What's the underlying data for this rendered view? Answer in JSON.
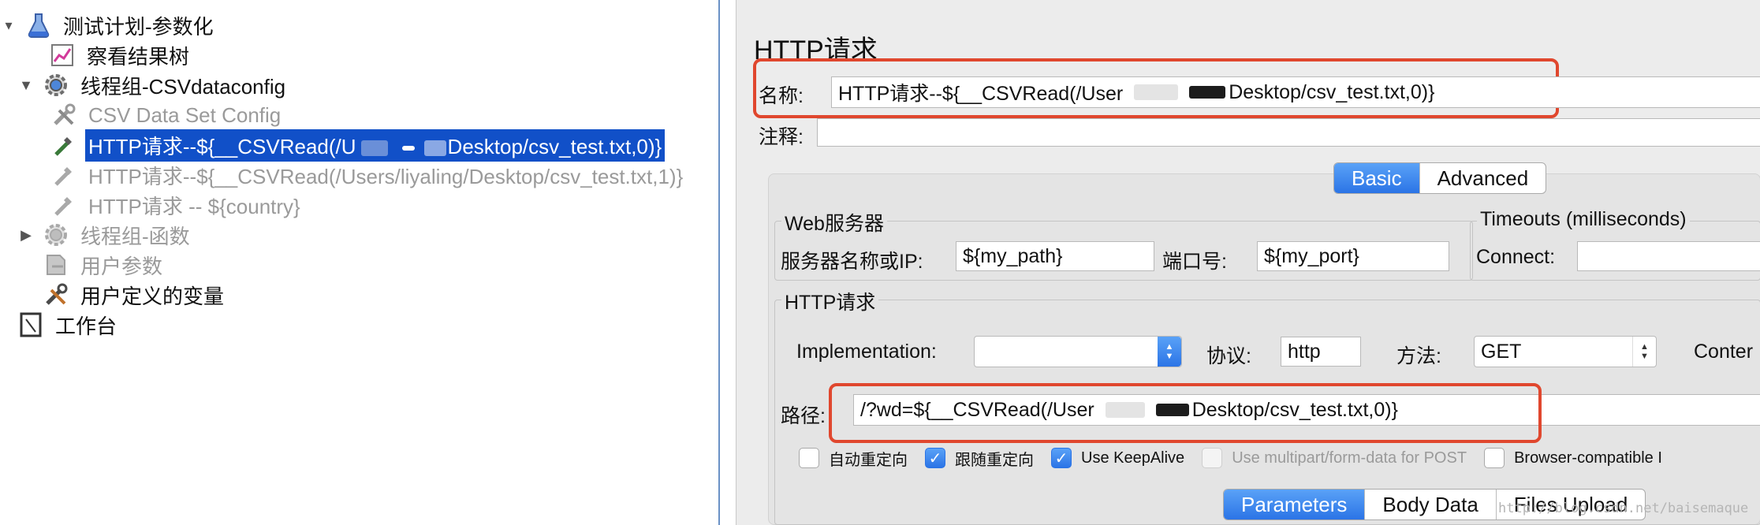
{
  "tree": {
    "items": [
      {
        "label": "测试计划-参数化",
        "icon": "flask-icon",
        "toggle": "▾",
        "disabled": false,
        "selected": false
      },
      {
        "label": "察看结果树",
        "icon": "chart-listener-icon",
        "toggle": "",
        "disabled": false,
        "selected": false
      },
      {
        "label": "线程组-CSVdataconfig",
        "icon": "gear-icon",
        "toggle": "▼",
        "disabled": false,
        "selected": false
      },
      {
        "label": "CSV Data Set Config",
        "icon": "wrench-icon",
        "toggle": "",
        "disabled": true,
        "selected": false
      },
      {
        "label_prefix": "HTTP请求--${__CSVRead(/U",
        "label_suffix": "Desktop/csv_test.txt,0)}",
        "icon": "pipette-icon",
        "toggle": "",
        "disabled": false,
        "selected": true
      },
      {
        "label": "HTTP请求--${__CSVRead(/Users/liyaling/Desktop/csv_test.txt,1)}",
        "icon": "pipette-icon",
        "toggle": "",
        "disabled": true,
        "selected": false
      },
      {
        "label": "HTTP请求 -- ${country}",
        "icon": "pipette-icon",
        "toggle": "",
        "disabled": true,
        "selected": false
      },
      {
        "label": "线程组-函数",
        "icon": "gear-icon",
        "toggle": "▶",
        "disabled": true,
        "selected": false
      },
      {
        "label": "用户参数",
        "icon": "document-icon",
        "toggle": "",
        "disabled": true,
        "selected": false
      },
      {
        "label": "用户定义的变量",
        "icon": "wrench-icon",
        "toggle": "",
        "disabled": false,
        "selected": false
      },
      {
        "label": "工作台",
        "icon": "workbench-icon",
        "toggle": "",
        "disabled": false,
        "selected": false
      }
    ]
  },
  "form": {
    "title": "HTTP请求",
    "name_label": "名称:",
    "name_value_prefix": "HTTP请求--${__CSVRead(/User",
    "name_value_suffix": "Desktop/csv_test.txt,0)}",
    "comment_label": "注释:",
    "comment_value": "",
    "tabs": [
      "Basic",
      "Advanced"
    ],
    "active_tab": "Basic",
    "web_server": {
      "title": "Web服务器",
      "server_label": "服务器名称或IP:",
      "server_value": "${my_path}",
      "port_label": "端口号:",
      "port_value": "${my_port}"
    },
    "timeouts": {
      "title": "Timeouts (milliseconds)",
      "connect_label": "Connect:",
      "connect_value": ""
    },
    "http_request": {
      "title": "HTTP请求",
      "implementation_label": "Implementation:",
      "implementation_value": "",
      "protocol_label": "协议:",
      "protocol_value": "http",
      "method_label": "方法:",
      "method_value": "GET",
      "content_label": "Conter",
      "path_label": "路径:",
      "path_value_prefix": "/?wd=${__CSVRead(/User",
      "path_value_suffix": "Desktop/csv_test.txt,0)}"
    },
    "checkboxes": [
      {
        "label": "自动重定向",
        "checked": false,
        "disabled": false
      },
      {
        "label": "跟随重定向",
        "checked": true,
        "disabled": false
      },
      {
        "label": "Use KeepAlive",
        "checked": true,
        "disabled": false
      },
      {
        "label": "Use multipart/form-data for POST",
        "checked": false,
        "disabled": true
      },
      {
        "label": "Browser-compatible I",
        "checked": false,
        "disabled": false
      }
    ],
    "bottom_tabs": [
      "Parameters",
      "Body Data",
      "Files Upload"
    ],
    "active_bottom_tab": "Parameters"
  },
  "watermark": "http://blog.csdn.net/baisemaque",
  "colors": {
    "selection": "#1150c8",
    "accent_blue": "#2b74e6",
    "highlight_red": "#e0472e",
    "panel_bg": "#ececec"
  }
}
